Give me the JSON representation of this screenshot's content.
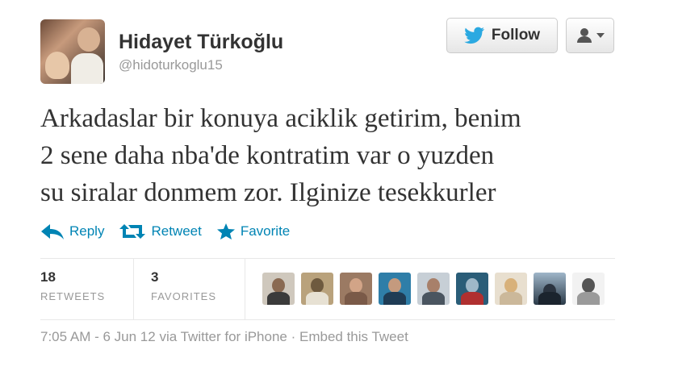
{
  "user": {
    "name": "Hidayet Türkoğlu",
    "handle": "@hidoturkoglu15"
  },
  "buttons": {
    "follow_label": "Follow",
    "follow_icon": "twitter-bird-icon",
    "user_menu_icon": "user-dropdown-icon"
  },
  "tweet": {
    "lines": [
      "Arkadaslar bir konuya aciklik getirim, benim",
      "2 sene daha nba'de kontratim var o yuzden",
      "su siralar donmem zor. Ilginize tesekkurler"
    ]
  },
  "actions": [
    {
      "label": "Reply",
      "icon": "reply-arrow-icon"
    },
    {
      "label": "Retweet",
      "icon": "retweet-icon"
    },
    {
      "label": "Favorite",
      "icon": "star-icon"
    }
  ],
  "stats": {
    "retweets": {
      "count": "18",
      "label": "RETWEETS"
    },
    "favorites": {
      "count": "3",
      "label": "FAVORITES"
    }
  },
  "favoriter_avatars": 9,
  "meta": {
    "time": "7:05 AM",
    "sep1": " - ",
    "date": "6 Jun 12",
    "via_prefix": " via ",
    "client": "Twitter for iPhone",
    "sep2": " · ",
    "embed": "Embed this Tweet"
  },
  "colors": {
    "link": "#0084b4",
    "muted": "#999999",
    "text": "#333333",
    "twitter_blue": "#2ba9e1"
  }
}
